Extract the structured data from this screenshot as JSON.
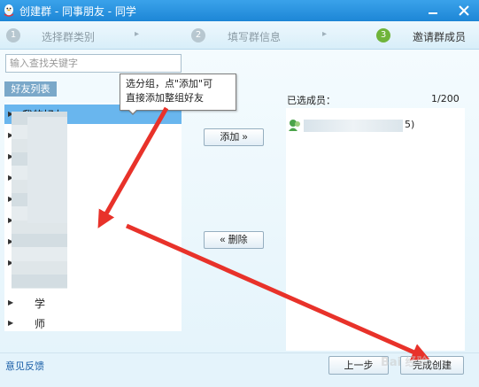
{
  "window": {
    "title": "创建群 - 同事朋友 - 同学",
    "icons": {
      "app": "qq-penguin-icon",
      "minimize": "minimize-icon",
      "close": "close-icon"
    }
  },
  "steps": [
    {
      "number": "1",
      "label": "选择群类别",
      "active": false
    },
    {
      "number": "2",
      "label": "填写群信息",
      "active": false
    },
    {
      "number": "3",
      "label": "邀请群成员",
      "active": true
    }
  ],
  "step_separator": "▸",
  "search": {
    "placeholder": "输入查找关键字",
    "value": ""
  },
  "friends_tab": "好友列表",
  "friend_groups": [
    {
      "name": "我的好友",
      "selected": true
    },
    {
      "name": "朋",
      "selected": false
    },
    {
      "name": "",
      "selected": false
    },
    {
      "name": "",
      "selected": false
    },
    {
      "name": "",
      "selected": false
    },
    {
      "name": "",
      "selected": false
    },
    {
      "name": "",
      "selected": false
    },
    {
      "name": "",
      "selected": false
    },
    {
      "name": "学",
      "selected": false
    },
    {
      "name": "师",
      "selected": false
    }
  ],
  "tooltip": {
    "line1": "选分组，点\"添加\"可",
    "line2": "直接添加整组好友"
  },
  "buttons": {
    "add": "添加 »",
    "remove": "« 删除",
    "prev": "上一步",
    "finish": "完成创建"
  },
  "selected_members": {
    "label": "已选成员：",
    "count": "1/200",
    "items": [
      {
        "suffix": "5)",
        "icon": "member-avatar-icon"
      }
    ]
  },
  "footer": {
    "feedback": "意见反馈"
  },
  "watermark": "Bai 经验",
  "colors": {
    "titlebar": "#1d86d6",
    "selection": "#69b6ee",
    "annotation_arrow": "#e8322a",
    "step_active": "#6fb43a"
  }
}
